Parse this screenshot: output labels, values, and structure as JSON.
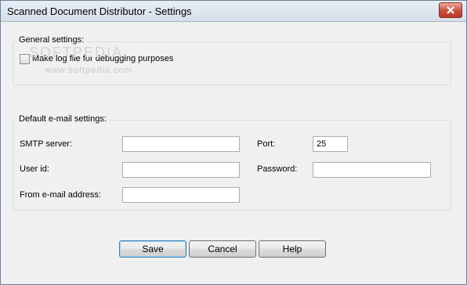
{
  "window": {
    "title": "Scanned Document Distributor - Settings"
  },
  "general": {
    "title": "General settings:",
    "debug_log_label": "Make log file for debugging purposes",
    "debug_log_checked": false
  },
  "email": {
    "title": "Default e-mail settings:",
    "smtp_label": "SMTP server:",
    "smtp_value": "",
    "port_label": "Port:",
    "port_value": "25",
    "userid_label": "User id:",
    "userid_value": "",
    "password_label": "Password:",
    "password_value": "",
    "from_label": "From e-mail address:",
    "from_value": ""
  },
  "buttons": {
    "save": "Save",
    "cancel": "Cancel",
    "help": "Help"
  },
  "watermark": {
    "large": "SOFTPEDIA",
    "small": "www.softpedia.com"
  }
}
